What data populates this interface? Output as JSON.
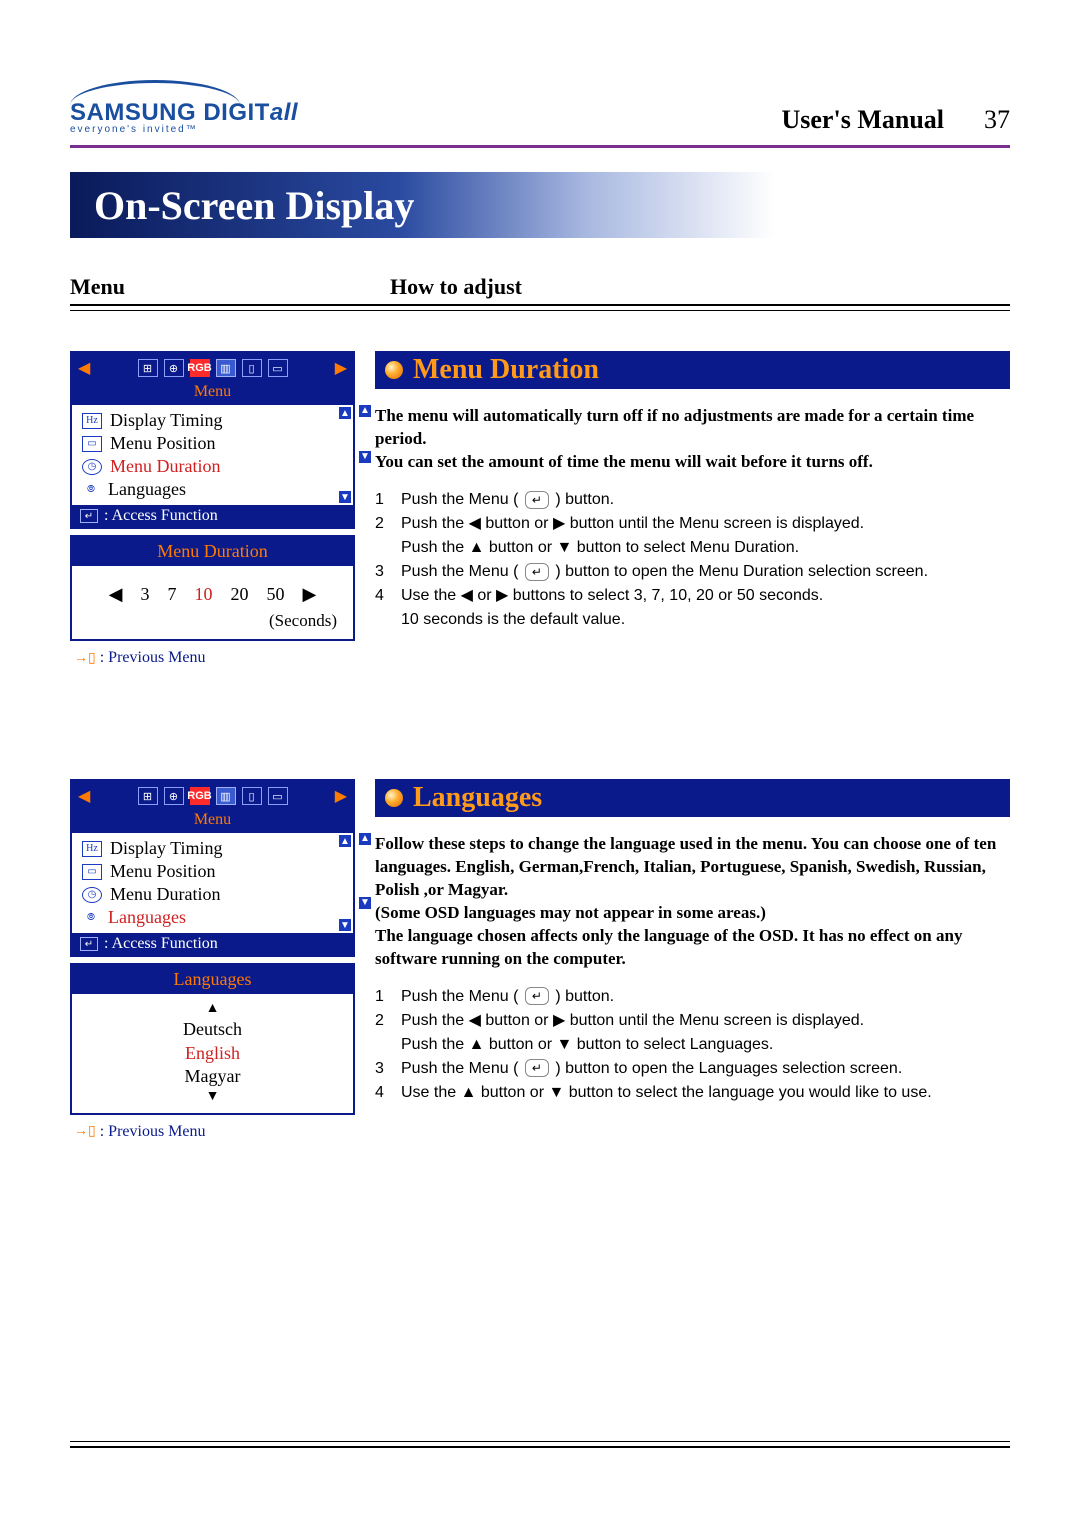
{
  "header": {
    "brand1": "SAMSUNG DIGIT",
    "brand2": "all",
    "tagline": "everyone's invited™",
    "manual": "User's Manual",
    "page": "37"
  },
  "banner": "On-Screen Display",
  "columns": {
    "menu": "Menu",
    "howto": "How to adjust"
  },
  "osd_top": {
    "menu_label": "Menu",
    "items": [
      "Display Timing",
      "Menu Position",
      "Menu Duration",
      "Languages"
    ],
    "foot": ": Access Function"
  },
  "section1": {
    "title": "Menu Duration",
    "sub_title": "Menu Duration",
    "values": [
      "3",
      "7",
      "10",
      "20",
      "50"
    ],
    "selected": "10",
    "unit": "(Seconds)",
    "prev": ": Previous Menu",
    "intro": "The menu will automatically turn off if no adjustments are made for a certain time period.\nYou can set the amount of time the menu will wait before it turns off.",
    "steps": [
      "Push the Menu ( ↵ ) button.",
      "Push the ◀ button or ▶ button until the Menu screen is displayed.\nPush the ▲ button or ▼ button to select Menu Duration.",
      "Push the Menu ( ↵ ) button to open the Menu Duration selection screen.",
      "Use the ◀ or ▶ buttons to select 3, 7, 10, 20 or 50 seconds.\n10 seconds is the default value."
    ]
  },
  "section2": {
    "title": "Languages",
    "sub_title": "Languages",
    "values": [
      "Deutsch",
      "English",
      "Magyar"
    ],
    "selected": "English",
    "prev": ": Previous Menu",
    "intro": "Follow these steps to change the language used in the menu. You can choose one of ten languages. English, German,French, Italian, Portuguese, Spanish, Swedish, Russian, Polish ,or Magyar.\n(Some OSD languages may not appear in some areas.)\nThe language chosen affects only the language of the OSD. It has no effect on any software running on the computer.",
    "steps": [
      "Push the Menu ( ↵ ) button.",
      "Push the ◀ button or ▶ button until the Menu screen is displayed.\nPush the ▲ button or ▼ button to select Languages.",
      "Push the Menu ( ↵ ) button to open the Languages selection screen.",
      "Use the ▲ button or ▼ button to select the language you would like to use."
    ]
  }
}
